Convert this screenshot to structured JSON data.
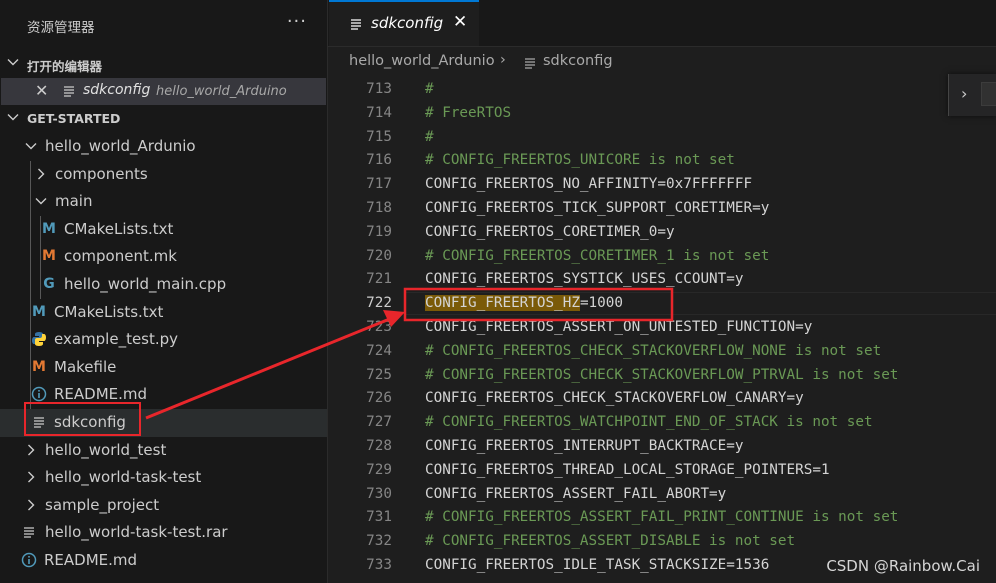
{
  "sidebar": {
    "title": "资源管理器",
    "more": "···",
    "open_editors": {
      "header": "打开的编辑器",
      "item": {
        "name": "sdkconfig",
        "description": "hello_world_Arduino"
      }
    },
    "workspace": {
      "header": "GET-STARTED"
    },
    "tree": [
      {
        "label": "hello_world_Ardunio",
        "kind": "folder",
        "expanded": true
      },
      {
        "label": "components",
        "kind": "folder",
        "expanded": false
      },
      {
        "label": "main",
        "kind": "folder",
        "expanded": true
      },
      {
        "label": "CMakeLists.txt",
        "kind": "file",
        "icon": "M"
      },
      {
        "label": "component.mk",
        "kind": "file",
        "icon": "M"
      },
      {
        "label": "hello_world_main.cpp",
        "kind": "file",
        "icon": "G"
      },
      {
        "label": "CMakeLists.txt",
        "kind": "file",
        "icon": "M"
      },
      {
        "label": "example_test.py",
        "kind": "file",
        "icon": "py"
      },
      {
        "label": "Makefile",
        "kind": "file",
        "icon": "M"
      },
      {
        "label": "README.md",
        "kind": "file",
        "icon": "i"
      },
      {
        "label": "sdkconfig",
        "kind": "file",
        "icon": "lines"
      },
      {
        "label": "hello_world_test",
        "kind": "folder",
        "expanded": false
      },
      {
        "label": "hello_world-task-test",
        "kind": "folder",
        "expanded": false
      },
      {
        "label": "sample_project",
        "kind": "folder",
        "expanded": false
      },
      {
        "label": "hello_world-task-test.rar",
        "kind": "file",
        "icon": "lines"
      },
      {
        "label": "README.md",
        "kind": "file",
        "icon": "i"
      }
    ]
  },
  "editor": {
    "tab": {
      "name": "sdkconfig",
      "close": "✕"
    },
    "breadcrumb": {
      "folder": "hello_world_Ardunio",
      "separator": "›",
      "file": "sdkconfig"
    },
    "find_widget": {
      "toggle": "›"
    },
    "lines": [
      {
        "n": "713",
        "t": "#",
        "c": true
      },
      {
        "n": "714",
        "t": "# FreeRTOS",
        "c": true
      },
      {
        "n": "715",
        "t": "#",
        "c": true
      },
      {
        "n": "716",
        "t": "# CONFIG_FREERTOS_UNICORE is not set",
        "c": true
      },
      {
        "n": "717",
        "t": "CONFIG_FREERTOS_NO_AFFINITY=0x7FFFFFFF",
        "c": false
      },
      {
        "n": "718",
        "t": "CONFIG_FREERTOS_TICK_SUPPORT_CORETIMER=y",
        "c": false
      },
      {
        "n": "719",
        "t": "CONFIG_FREERTOS_CORETIMER_0=y",
        "c": false
      },
      {
        "n": "720",
        "t": "# CONFIG_FREERTOS_CORETIMER_1 is not set",
        "c": true
      },
      {
        "n": "721",
        "t": "CONFIG_FREERTOS_SYSTICK_USES_CCOUNT=y",
        "c": false
      },
      {
        "n": "722",
        "t": "CONFIG_FREERTOS_HZ=1000",
        "c": false,
        "current": true,
        "match": "CONFIG_FREERTOS_HZ",
        "rest": "=1000"
      },
      {
        "n": "723",
        "t": "CONFIG_FREERTOS_ASSERT_ON_UNTESTED_FUNCTION=y",
        "c": false
      },
      {
        "n": "724",
        "t": "# CONFIG_FREERTOS_CHECK_STACKOVERFLOW_NONE is not set",
        "c": true
      },
      {
        "n": "725",
        "t": "# CONFIG_FREERTOS_CHECK_STACKOVERFLOW_PTRVAL is not set",
        "c": true
      },
      {
        "n": "726",
        "t": "CONFIG_FREERTOS_CHECK_STACKOVERFLOW_CANARY=y",
        "c": false
      },
      {
        "n": "727",
        "t": "# CONFIG_FREERTOS_WATCHPOINT_END_OF_STACK is not set",
        "c": true
      },
      {
        "n": "728",
        "t": "CONFIG_FREERTOS_INTERRUPT_BACKTRACE=y",
        "c": false
      },
      {
        "n": "729",
        "t": "CONFIG_FREERTOS_THREAD_LOCAL_STORAGE_POINTERS=1",
        "c": false
      },
      {
        "n": "730",
        "t": "CONFIG_FREERTOS_ASSERT_FAIL_ABORT=y",
        "c": false
      },
      {
        "n": "731",
        "t": "# CONFIG_FREERTOS_ASSERT_FAIL_PRINT_CONTINUE is not set",
        "c": true
      },
      {
        "n": "732",
        "t": "# CONFIG_FREERTOS_ASSERT_DISABLE is not set",
        "c": true
      },
      {
        "n": "733",
        "t": "CONFIG_FREERTOS_IDLE_TASK_STACKSIZE=1536",
        "c": false
      }
    ]
  },
  "watermark": "CSDN @Rainbow.Cai",
  "colors": {
    "annotation_red": "#e8262b",
    "comment_green": "#6a9955",
    "search_match": "#7a5a08",
    "tab_accent": "#0078d4"
  }
}
